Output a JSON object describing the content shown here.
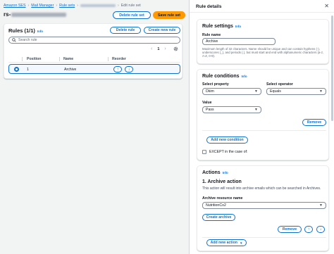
{
  "breadcrumb": {
    "items": [
      "Amazon SES",
      "Mail Manager",
      "Rule sets"
    ],
    "current": "Edit rule set"
  },
  "header": {
    "title_prefix": "rs-",
    "delete_label": "Delete rule set",
    "save_label": "Save rule set"
  },
  "rules": {
    "title": "Rules (1/1)",
    "info": "Info",
    "delete_label": "Delete rule",
    "create_label": "Create new rule",
    "search_placeholder": "Search rule",
    "page": "1",
    "columns": [
      "Position",
      "Name",
      "Reorder"
    ],
    "rows": [
      {
        "position": "1",
        "name": "Archive",
        "selected": true
      }
    ]
  },
  "details": {
    "title": "Rule details",
    "settings": {
      "title": "Rule settings",
      "info": "Info",
      "name_label": "Rule name",
      "name_value": "Archive",
      "hint": "Maximum length of 32 characters. Name should be unique and can contain hyphens (-), underscores (_), and periods (.), but must start and end with alphanumeric characters (a-z, A-Z, 0-9)."
    },
    "conditions": {
      "title": "Rule conditions",
      "info": "Info",
      "property_label": "Select property",
      "property_value": "Dkim",
      "operator_label": "Select operator",
      "operator_value": "Equals",
      "value_label": "Value",
      "value_value": "Pass",
      "remove_label": "Remove",
      "add_label": "Add new condition",
      "except_label": "EXCEPT in the case of:"
    },
    "actions": {
      "title": "Actions",
      "info": "Info",
      "action_title": "1. Archive action",
      "action_desc": "This action will result into archive emails which can be searched in Archives.",
      "resource_label": "Archive resource name",
      "resource_value": "NutritionCo2",
      "create_archive_label": "Create archive",
      "remove_label": "Remove",
      "add_action_label": "Add new action"
    }
  },
  "colors": {
    "accent": "#0972d3",
    "primary_button": "#ff9900",
    "background": "#f2f3f3"
  }
}
